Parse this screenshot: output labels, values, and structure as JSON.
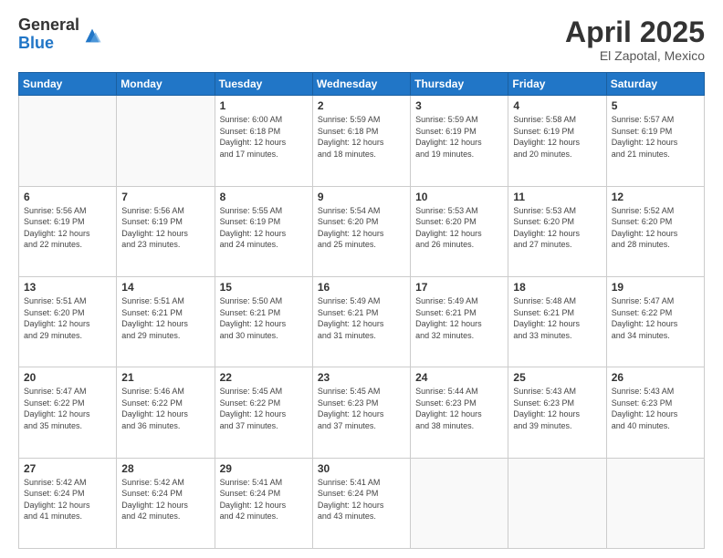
{
  "logo": {
    "general": "General",
    "blue": "Blue"
  },
  "header": {
    "month": "April 2025",
    "location": "El Zapotal, Mexico"
  },
  "weekdays": [
    "Sunday",
    "Monday",
    "Tuesday",
    "Wednesday",
    "Thursday",
    "Friday",
    "Saturday"
  ],
  "weeks": [
    [
      {
        "day": null,
        "info": null
      },
      {
        "day": null,
        "info": null
      },
      {
        "day": "1",
        "info": "Sunrise: 6:00 AM\nSunset: 6:18 PM\nDaylight: 12 hours\nand 17 minutes."
      },
      {
        "day": "2",
        "info": "Sunrise: 5:59 AM\nSunset: 6:18 PM\nDaylight: 12 hours\nand 18 minutes."
      },
      {
        "day": "3",
        "info": "Sunrise: 5:59 AM\nSunset: 6:19 PM\nDaylight: 12 hours\nand 19 minutes."
      },
      {
        "day": "4",
        "info": "Sunrise: 5:58 AM\nSunset: 6:19 PM\nDaylight: 12 hours\nand 20 minutes."
      },
      {
        "day": "5",
        "info": "Sunrise: 5:57 AM\nSunset: 6:19 PM\nDaylight: 12 hours\nand 21 minutes."
      }
    ],
    [
      {
        "day": "6",
        "info": "Sunrise: 5:56 AM\nSunset: 6:19 PM\nDaylight: 12 hours\nand 22 minutes."
      },
      {
        "day": "7",
        "info": "Sunrise: 5:56 AM\nSunset: 6:19 PM\nDaylight: 12 hours\nand 23 minutes."
      },
      {
        "day": "8",
        "info": "Sunrise: 5:55 AM\nSunset: 6:19 PM\nDaylight: 12 hours\nand 24 minutes."
      },
      {
        "day": "9",
        "info": "Sunrise: 5:54 AM\nSunset: 6:20 PM\nDaylight: 12 hours\nand 25 minutes."
      },
      {
        "day": "10",
        "info": "Sunrise: 5:53 AM\nSunset: 6:20 PM\nDaylight: 12 hours\nand 26 minutes."
      },
      {
        "day": "11",
        "info": "Sunrise: 5:53 AM\nSunset: 6:20 PM\nDaylight: 12 hours\nand 27 minutes."
      },
      {
        "day": "12",
        "info": "Sunrise: 5:52 AM\nSunset: 6:20 PM\nDaylight: 12 hours\nand 28 minutes."
      }
    ],
    [
      {
        "day": "13",
        "info": "Sunrise: 5:51 AM\nSunset: 6:20 PM\nDaylight: 12 hours\nand 29 minutes."
      },
      {
        "day": "14",
        "info": "Sunrise: 5:51 AM\nSunset: 6:21 PM\nDaylight: 12 hours\nand 29 minutes."
      },
      {
        "day": "15",
        "info": "Sunrise: 5:50 AM\nSunset: 6:21 PM\nDaylight: 12 hours\nand 30 minutes."
      },
      {
        "day": "16",
        "info": "Sunrise: 5:49 AM\nSunset: 6:21 PM\nDaylight: 12 hours\nand 31 minutes."
      },
      {
        "day": "17",
        "info": "Sunrise: 5:49 AM\nSunset: 6:21 PM\nDaylight: 12 hours\nand 32 minutes."
      },
      {
        "day": "18",
        "info": "Sunrise: 5:48 AM\nSunset: 6:21 PM\nDaylight: 12 hours\nand 33 minutes."
      },
      {
        "day": "19",
        "info": "Sunrise: 5:47 AM\nSunset: 6:22 PM\nDaylight: 12 hours\nand 34 minutes."
      }
    ],
    [
      {
        "day": "20",
        "info": "Sunrise: 5:47 AM\nSunset: 6:22 PM\nDaylight: 12 hours\nand 35 minutes."
      },
      {
        "day": "21",
        "info": "Sunrise: 5:46 AM\nSunset: 6:22 PM\nDaylight: 12 hours\nand 36 minutes."
      },
      {
        "day": "22",
        "info": "Sunrise: 5:45 AM\nSunset: 6:22 PM\nDaylight: 12 hours\nand 37 minutes."
      },
      {
        "day": "23",
        "info": "Sunrise: 5:45 AM\nSunset: 6:23 PM\nDaylight: 12 hours\nand 37 minutes."
      },
      {
        "day": "24",
        "info": "Sunrise: 5:44 AM\nSunset: 6:23 PM\nDaylight: 12 hours\nand 38 minutes."
      },
      {
        "day": "25",
        "info": "Sunrise: 5:43 AM\nSunset: 6:23 PM\nDaylight: 12 hours\nand 39 minutes."
      },
      {
        "day": "26",
        "info": "Sunrise: 5:43 AM\nSunset: 6:23 PM\nDaylight: 12 hours\nand 40 minutes."
      }
    ],
    [
      {
        "day": "27",
        "info": "Sunrise: 5:42 AM\nSunset: 6:24 PM\nDaylight: 12 hours\nand 41 minutes."
      },
      {
        "day": "28",
        "info": "Sunrise: 5:42 AM\nSunset: 6:24 PM\nDaylight: 12 hours\nand 42 minutes."
      },
      {
        "day": "29",
        "info": "Sunrise: 5:41 AM\nSunset: 6:24 PM\nDaylight: 12 hours\nand 42 minutes."
      },
      {
        "day": "30",
        "info": "Sunrise: 5:41 AM\nSunset: 6:24 PM\nDaylight: 12 hours\nand 43 minutes."
      },
      {
        "day": null,
        "info": null
      },
      {
        "day": null,
        "info": null
      },
      {
        "day": null,
        "info": null
      }
    ]
  ]
}
